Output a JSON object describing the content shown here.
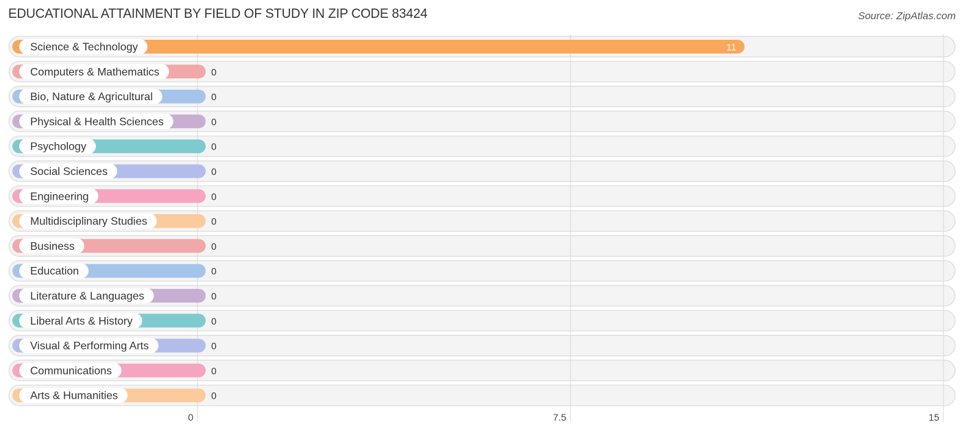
{
  "chart_data": {
    "type": "bar",
    "orientation": "horizontal",
    "title": "EDUCATIONAL ATTAINMENT BY FIELD OF STUDY IN ZIP CODE 83424",
    "source": "Source: ZipAtlas.com",
    "xlabel": "",
    "ylabel": "",
    "xlim": [
      0,
      15
    ],
    "xticks": [
      0,
      7.5,
      15
    ],
    "xtick_labels": [
      "0",
      "7.5",
      "15"
    ],
    "grid": true,
    "categories": [
      "Science & Technology",
      "Computers & Mathematics",
      "Bio, Nature & Agricultural",
      "Physical & Health Sciences",
      "Psychology",
      "Social Sciences",
      "Engineering",
      "Multidisciplinary Studies",
      "Business",
      "Education",
      "Literature & Languages",
      "Liberal Arts & History",
      "Visual & Performing Arts",
      "Communications",
      "Arts & Humanities"
    ],
    "values": [
      11,
      0,
      0,
      0,
      0,
      0,
      0,
      0,
      0,
      0,
      0,
      0,
      0,
      0,
      0
    ],
    "value_labels": [
      "11",
      "0",
      "0",
      "0",
      "0",
      "0",
      "0",
      "0",
      "0",
      "0",
      "0",
      "0",
      "0",
      "0",
      "0"
    ],
    "colors": [
      "#f9a75a",
      "#f0a8a8",
      "#a5c4ea",
      "#c9aed3",
      "#7dcbcf",
      "#b3bdec",
      "#f6a5c0",
      "#fbcb9d",
      "#f0a8a8",
      "#a5c4ea",
      "#c9aed3",
      "#7dcbcf",
      "#b3bdec",
      "#f6a5c0",
      "#fbcb9d"
    ]
  }
}
